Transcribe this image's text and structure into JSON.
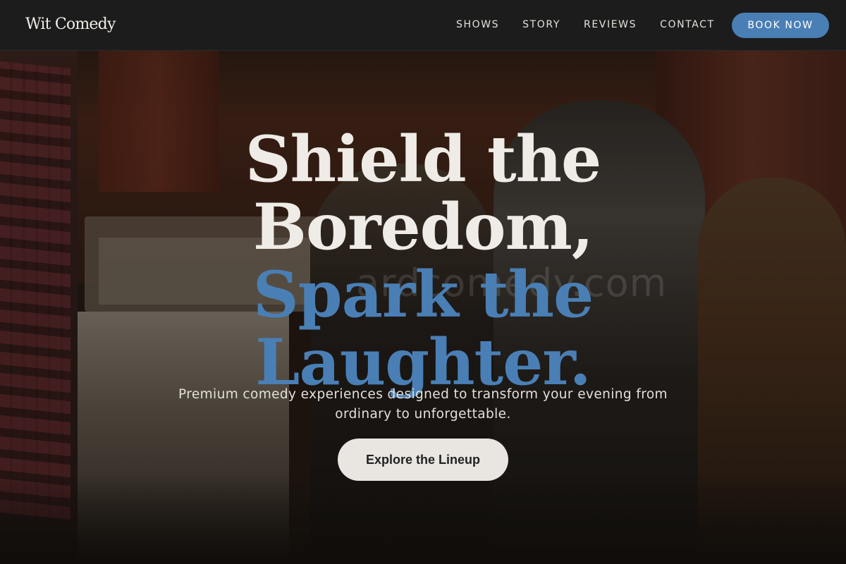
{
  "brand": {
    "name": "Wit Comedy"
  },
  "nav": {
    "links": [
      {
        "label": "SHOWS"
      },
      {
        "label": "STORY"
      },
      {
        "label": "REVIEWS"
      },
      {
        "label": "CONTACT"
      }
    ],
    "cta_label": "BOOK NOW"
  },
  "hero": {
    "headline_line1": "Shield the",
    "headline_line2": "Boredom,",
    "headline_line3": "Spark the",
    "headline_line4": "Laughter.",
    "subtitle": "Premium comedy experiences designed to transform your evening from ordinary to unforgettable.",
    "cta_label": "Explore the Lineup",
    "watermark": "ardcomedy.com"
  },
  "colors": {
    "accent": "#4a7fb5",
    "header_bg": "#1c1c1c",
    "headline_light": "#efebe6",
    "cta_bg": "#e9e6e2"
  }
}
